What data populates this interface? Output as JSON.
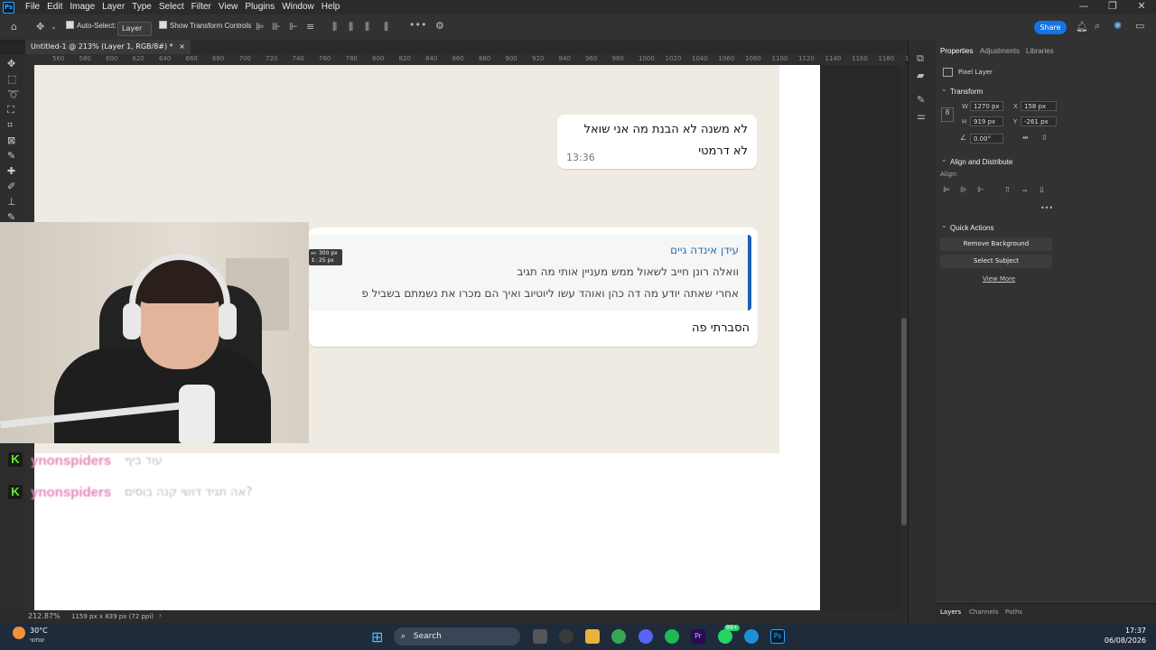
{
  "app": {
    "logo_text": "Ps"
  },
  "menu": [
    "File",
    "Edit",
    "Image",
    "Layer",
    "Type",
    "Select",
    "Filter",
    "View",
    "Plugins",
    "Window",
    "Help"
  ],
  "window_controls": {
    "minimize": "—",
    "maximize": "❐",
    "close": "✕"
  },
  "options_bar": {
    "auto_select_label": "Auto-Select:",
    "layer_select_value": "Layer",
    "show_transform_label": "Show Transform Controls",
    "share_label": "Share"
  },
  "document_tab": {
    "title": "Untitled-1 @ 213% (Layer 1, RGB/8#) *",
    "close": "×"
  },
  "ruler_ticks": [
    "560",
    "580",
    "600",
    "620",
    "640",
    "660",
    "680",
    "700",
    "720",
    "740",
    "760",
    "780",
    "800",
    "820",
    "840",
    "860",
    "880",
    "900",
    "920",
    "940",
    "960",
    "980",
    "1000",
    "1020",
    "1040",
    "1060",
    "1080",
    "1100",
    "1120",
    "1140",
    "1160",
    "1180",
    "1200"
  ],
  "chat": {
    "bubble1": {
      "line1": "לא משנה לא הבנת מה אני שואל",
      "line2": "לא דרמטי",
      "time": "13:36"
    },
    "bubble2": {
      "quote_name": "עידן אינדה גיים",
      "quote_line1": "וואלה רונן חייב לשאול ממש מעניין אותי מה תגיב",
      "quote_line2": "אחרי שאתה יודע מה דה כהן ואוהד עשו ליוטיוב ואיך הם מכרו את נשמתם בשביל פ",
      "reply": "הסברתי פה"
    },
    "measure_w": "↔: 300 px",
    "measure_h": "↕: 25 px"
  },
  "kick_chat": [
    {
      "username": "ynonspiders",
      "message": "עוד ביף"
    },
    {
      "username": "ynonspiders",
      "message": "?אה תגיד דושי קנה בוסים"
    }
  ],
  "status": {
    "zoom": "212.87%",
    "dimensions": "1159 px x 839 px (72 ppi)"
  },
  "properties": {
    "tabs": [
      "Properties",
      "Adjustments",
      "Libraries"
    ],
    "pixel_layer": "Pixel Layer",
    "transform_title": "Transform",
    "w_label": "W",
    "w_value": "1270 px",
    "h_label": "H",
    "h_value": "919 px",
    "x_label": "X",
    "x_value": "158 px",
    "y_label": "Y",
    "y_value": "-261 px",
    "angle_value": "0.00°",
    "align_title": "Align and Distribute",
    "align_label": "Align:",
    "more": "•••",
    "quick_actions_title": "Quick Actions",
    "remove_bg": "Remove Background",
    "select_subject": "Select Subject",
    "view_more": "View More"
  },
  "layers_tabs": [
    "Layers",
    "Channels",
    "Paths"
  ],
  "taskbar": {
    "temp": "30°C",
    "weather_text": "שמשי",
    "search": "Search",
    "badge": "99+",
    "time": "17:37",
    "date": "06/08/2026"
  },
  "colors": {
    "accent": "#1473e6",
    "kick_green": "#53fc18",
    "quote_bar": "#1a5fb4"
  }
}
